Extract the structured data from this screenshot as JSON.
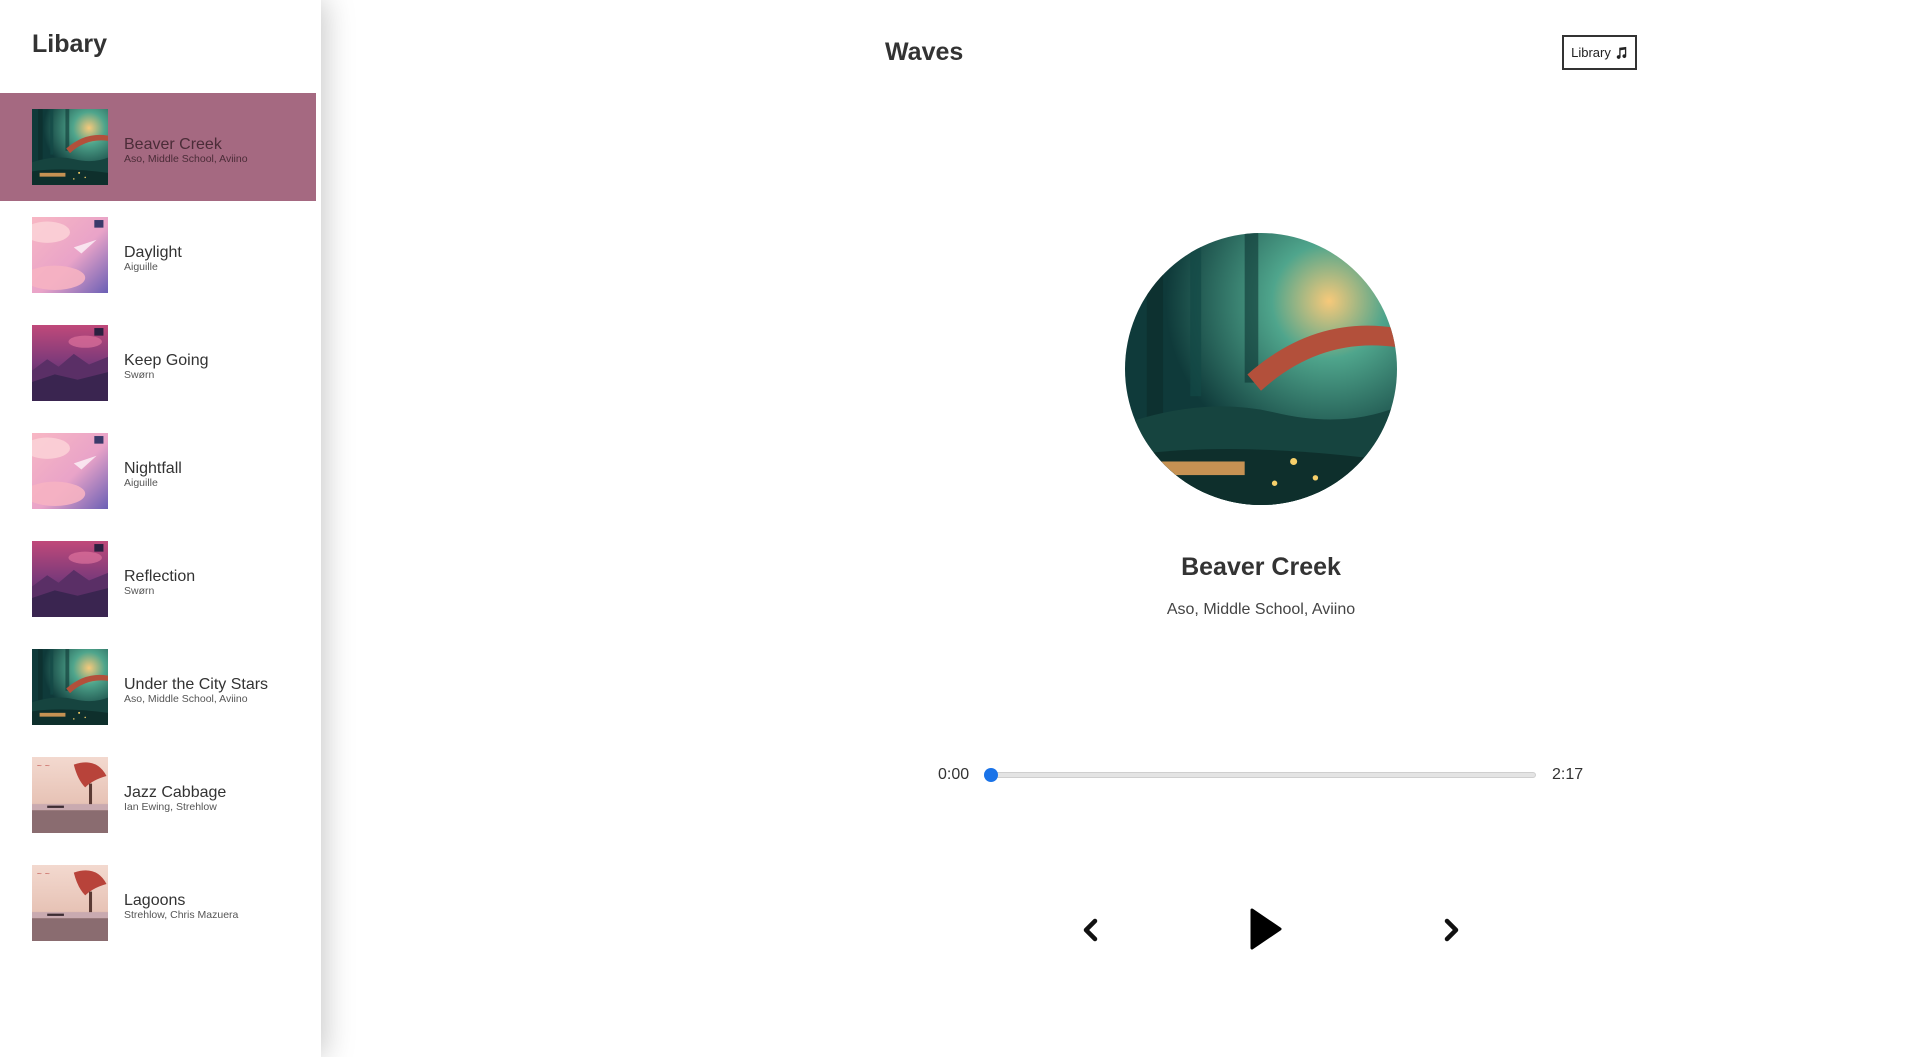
{
  "sidebar": {
    "title": "Libary",
    "tracks": [
      {
        "name": "Beaver Creek",
        "artist": "Aso, Middle School, Aviino",
        "active": true,
        "cover": "forest-teal-cover"
      },
      {
        "name": "Daylight",
        "artist": "Aiguille",
        "active": false,
        "cover": "pink-sky-cover"
      },
      {
        "name": "Keep Going",
        "artist": "Swørn",
        "active": false,
        "cover": "purple-mountain-cover"
      },
      {
        "name": "Nightfall",
        "artist": "Aiguille",
        "active": false,
        "cover": "pink-sky-cover"
      },
      {
        "name": "Reflection",
        "artist": "Swørn",
        "active": false,
        "cover": "purple-mountain-cover"
      },
      {
        "name": "Under the City Stars",
        "artist": "Aso, Middle School, Aviino",
        "active": false,
        "cover": "forest-teal-cover"
      },
      {
        "name": "Jazz Cabbage",
        "artist": "Ian Ewing, Strehlow",
        "active": false,
        "cover": "red-tree-lake-cover"
      },
      {
        "name": "Lagoons",
        "artist": "Strehlow, Chris Mazuera",
        "active": false,
        "cover": "red-tree-lake-cover"
      }
    ]
  },
  "header": {
    "title": "Waves",
    "library_button_label": "Library",
    "library_button_icon": "music-note-icon"
  },
  "song": {
    "name": "Beaver Creek",
    "artist": "Aso, Middle School, Aviino",
    "cover": "forest-teal-cover"
  },
  "time": {
    "current": "0:00",
    "duration": "2:17",
    "progress": 0
  },
  "controls": {
    "prev_icon": "chevron-left-icon",
    "play_icon": "play-icon",
    "next_icon": "chevron-right-icon"
  },
  "colors": {
    "active_track_bg": "#a56981",
    "slider_accent": "#1a73e8"
  }
}
